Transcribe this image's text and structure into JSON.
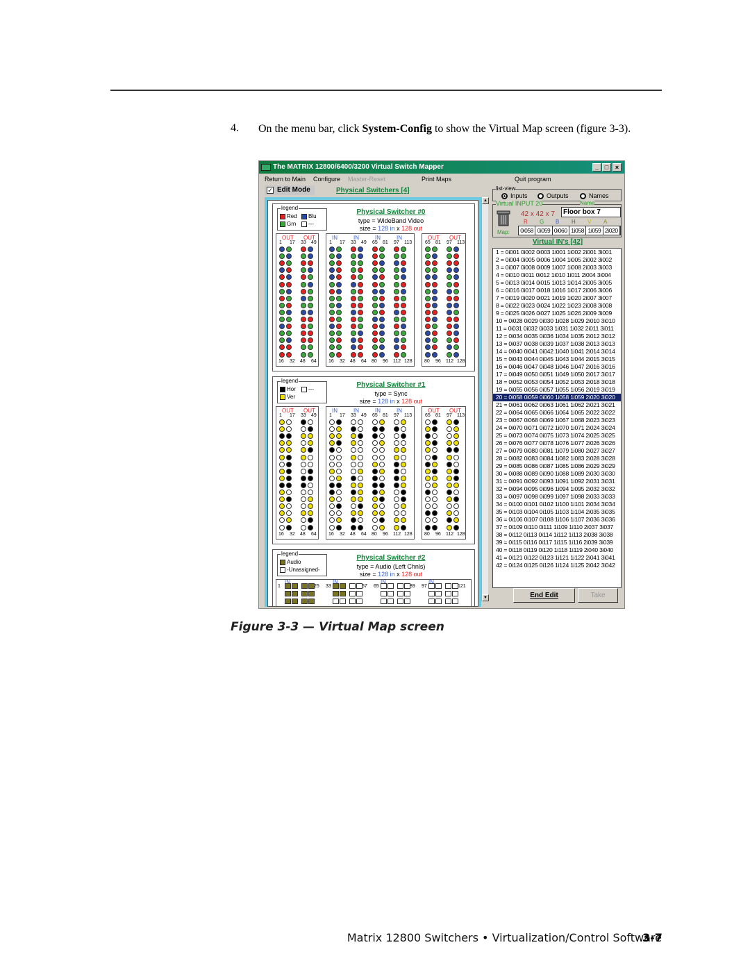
{
  "document": {
    "step_number": "4.",
    "step_text_before": "On the menu bar, click ",
    "step_text_bold": "System-Config",
    "step_text_after": " to show the Virtual Map screen (figure 3-3).",
    "caption": "Figure 3-3 — Virtual Map screen",
    "footer": "Matrix 12800 Switchers • Virtualization/Control Software",
    "page_number": "3-7"
  },
  "window": {
    "title": "The MATRIX 12800/6400/3200 Virtual Switch Mapper",
    "controls": [
      "_",
      "□",
      "×"
    ],
    "menu": [
      {
        "label": "Return to Main",
        "enabled": true
      },
      {
        "label": "Configure",
        "enabled": true
      },
      {
        "label": "Master-Reset",
        "enabled": false
      },
      {
        "label": "Print Maps",
        "enabled": true
      },
      {
        "label": "Quit program",
        "enabled": true
      }
    ],
    "edit_mode": {
      "label": "Edit Mode",
      "checked": true
    },
    "physical_switchers_label": "Physical Switchers [4]"
  },
  "switchers": [
    {
      "title": "Physical Switcher #0",
      "type": "type = WideBand Video",
      "size_prefix": "size =",
      "size_in": "128 in",
      "size_x": "x",
      "size_out": "128 out",
      "legend_title": "legend",
      "legend": [
        {
          "label": "Red",
          "color": "#e82020"
        },
        {
          "label": "Blu",
          "color": "#2a4aa8"
        },
        {
          "label": "Grn",
          "color": "#3aaa3a"
        },
        {
          "label": "---",
          "color": "#ffffff"
        }
      ],
      "palette": [
        "#e82020",
        "#3aaa3a",
        "#2a4aa8"
      ]
    },
    {
      "title": "Physical Switcher #1",
      "type": "type = Sync",
      "size_prefix": "size =",
      "size_in": "128 in",
      "size_x": "x",
      "size_out": "128 out",
      "legend_title": "legend",
      "legend": [
        {
          "label": "Hor",
          "color": "#000000"
        },
        {
          "label": "---",
          "color": "#ffffff"
        },
        {
          "label": "Ver",
          "color": "#f0e000"
        }
      ],
      "palette": [
        "#000000",
        "#f0e000",
        "#ffffff"
      ]
    },
    {
      "title": "Physical Switcher #2",
      "type": "type = Audio (Left Chnls)",
      "size_prefix": "size =",
      "size_in": "128 in",
      "size_x": "x",
      "size_out": "128 out",
      "legend_title": "legend",
      "legend": [
        {
          "label": "Audio",
          "color": "#7a7420"
        },
        {
          "label": "-Unassigned-",
          "color": "#ffffff"
        }
      ],
      "palette": [
        "#7a7420",
        "#ffffff"
      ]
    }
  ],
  "grid_labels": {
    "out_header": "OUT",
    "in_header": "IN",
    "out_left_top": [
      "1",
      "17",
      "33",
      "49"
    ],
    "out_left_bottom": [
      "16",
      "32",
      "48",
      "64"
    ],
    "in_top": [
      "1",
      "17",
      "33",
      "49",
      "65",
      "81",
      "97",
      "113"
    ],
    "in_bottom": [
      "16",
      "32",
      "48",
      "64",
      "80",
      "96",
      "112",
      "128"
    ],
    "out_right_top": [
      "65",
      "81",
      "97",
      "113"
    ],
    "out_right_bottom": [
      "80",
      "96",
      "112",
      "128"
    ],
    "audio_row": [
      "1",
      "25",
      "33",
      "57",
      "65",
      "89",
      "97",
      "121"
    ]
  },
  "right_panel": {
    "list_view_title": "list-view",
    "list_view_options": [
      {
        "label": "Inputs",
        "selected": true
      },
      {
        "label": "Outputs",
        "selected": false
      },
      {
        "label": "Names",
        "selected": false
      }
    ],
    "virtual_input_title": "Virtual INPUT 20",
    "dimensions": "42 x 42 x 7",
    "name_label": "Name",
    "name_value": "Floor box 7",
    "map_label": "Map:",
    "channel_labels": [
      {
        "label": "R",
        "color": "#e82020"
      },
      {
        "label": "G",
        "color": "#2a9a2a"
      },
      {
        "label": "B",
        "color": "#3a5fd0"
      },
      {
        "label": "H",
        "color": "#555555"
      },
      {
        "label": "V",
        "color": "#c8b800"
      },
      {
        "label": "A",
        "color": "#8a8a30"
      }
    ],
    "map_values": [
      "0i058",
      "0i059",
      "0i060",
      "1i058",
      "1i059",
      "2i020"
    ],
    "virtual_ins_label": "Virtual IN's [42]",
    "selected_row": 20,
    "end_edit_label": "End Edit",
    "take_label": "Take",
    "rows": [
      "1 = 0i001 0i002 0i003 1i001 1i002 2i001 3i001",
      "2 = 0i004 0i005 0i006 1i004 1i005 2i002 3i002",
      "3 = 0i007 0i008 0i009 1i007 1i008 2i003 3i003",
      "4 = 0i010 0i011 0i012 1i010 1i011 2i004 3i004",
      "5 = 0i013 0i014 0i015 1i013 1i014 2i005 3i005",
      "6 = 0i016 0i017 0i018 1i016 1i017 2i006 3i006",
      "7 = 0i019 0i020 0i021 1i019 1i020 2i007 3i007",
      "8 = 0i022 0i023 0i024 1i022 1i023 2i008 3i008",
      "9 = 0i025 0i026 0i027 1i025 1i026 2i009 3i009",
      "10 = 0i028 0i029 0i030 1i028 1i029 2i010 3i010",
      "11 = 0i031 0i032 0i033 1i031 1i032 2i011 3i011",
      "12 = 0i034 0i035 0i036 1i034 1i035 2i012 3i012",
      "13 = 0i037 0i038 0i039 1i037 1i038 2i013 3i013",
      "14 = 0i040 0i041 0i042 1i040 1i041 2i014 3i014",
      "15 = 0i043 0i044 0i045 1i043 1i044 2i015 3i015",
      "16 = 0i046 0i047 0i048 1i046 1i047 2i016 3i016",
      "17 = 0i049 0i050 0i051 1i049 1i050 2i017 3i017",
      "18 = 0i052 0i053 0i054 1i052 1i053 2i018 3i018",
      "19 = 0i055 0i056 0i057 1i055 1i056 2i019 3i019",
      "20 = 0i058 0i059 0i060 1i058 1i059 2i020 3i020",
      "21 = 0i061 0i062 0i063 1i061 1i062 2i021 3i021",
      "22 = 0i064 0i065 0i066 1i064 1i065 2i022 3i022",
      "23 = 0i067 0i068 0i069 1i067 1i068 2i023 3i023",
      "24 = 0i070 0i071 0i072 1i070 1i071 2i024 3i024",
      "25 = 0i073 0i074 0i075 1i073 1i074 2i025 3i025",
      "26 = 0i076 0i077 0i078 1i076 1i077 2i026 3i026",
      "27 = 0i079 0i080 0i081 1i079 1i080 2i027 3i027",
      "28 = 0i082 0i083 0i084 1i082 1i083 2i028 3i028",
      "29 = 0i085 0i086 0i087 1i085 1i086 2i029 3i029",
      "30 = 0i088 0i089 0i090 1i088 1i089 2i030 3i030",
      "31 = 0i091 0i092 0i093 1i091 1i092 2i031 3i031",
      "32 = 0i094 0i095 0i096 1i094 1i095 2i032 3i032",
      "33 = 0i097 0i098 0i099 1i097 1i098 2i033 3i033",
      "34 = 0i100 0i101 0i102 1i100 1i101 2i034 3i034",
      "35 = 0i103 0i104 0i105 1i103 1i104 2i035 3i035",
      "36 = 0i106 0i107 0i108 1i106 1i107 2i036 3i036",
      "37 = 0i109 0i110 0i111 1i109 1i110 2i037 3i037",
      "38 = 0i112 0i113 0i114 1i112 1i113 2i038 3i038",
      "39 = 0i115 0i116 0i117 1i115 1i116 2i039 3i039",
      "40 = 0i118 0i119 0i120 1i118 1i119 2i040 3i040",
      "41 = 0i121 0i122 0i123 1i121 1i122 2i041 3i041",
      "42 = 0i124 0i125 0i126 1i124 1i125 2i042 3i042"
    ]
  }
}
